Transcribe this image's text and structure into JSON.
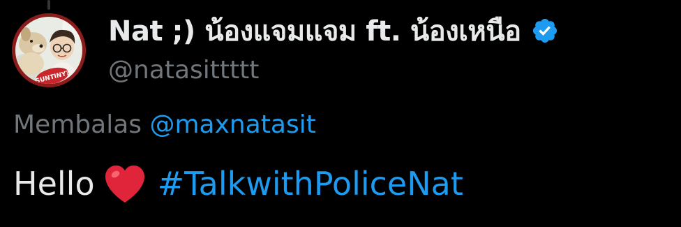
{
  "tweet": {
    "author": {
      "display_name": "Nat ;) น้องแจมแจม ft. น้องเหนือ",
      "handle": "@natasittttt",
      "verified": true,
      "avatar": {
        "badge_text": "SUNTINY?",
        "ring_color": "#8b1c1c"
      }
    },
    "reply_context": {
      "label": "Membalas",
      "mention": "@maxnatasit"
    },
    "body": {
      "text": "Hello",
      "emoji": "red-heart",
      "hashtag": "#TalkwithPoliceNat"
    }
  },
  "colors": {
    "background": "#000000",
    "primary_text": "#e7e9ea",
    "secondary_text": "#71767b",
    "link": "#1d9bf0",
    "heart": "#e0243a"
  }
}
